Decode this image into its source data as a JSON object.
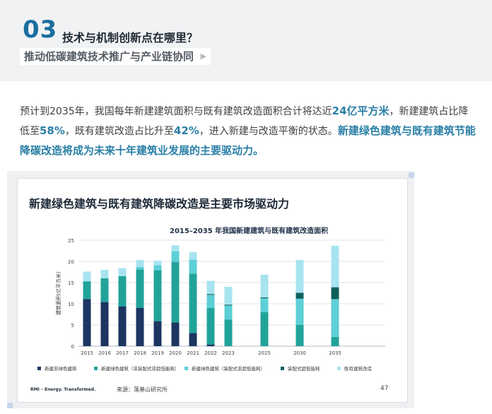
{
  "section": {
    "number": "03",
    "title": "技术与机制创新点在哪里？",
    "subtitle": "推动低碳建筑技术推广与产业链协同",
    "arrow_icon": "play-arrow-icon"
  },
  "paragraph": {
    "t1": "预计到2035年，我国每年新建建筑面积与既有建筑改造面积合计将达近",
    "h1": "24亿平方米",
    "t2": "，新建建筑占比降低至",
    "h2": "58%",
    "t3": "，既有建筑改造占比升至",
    "h3": "42%",
    "t4": "，进入新建与改造平衡的状态。",
    "h4": "新建绿色建筑与既有建筑节能降碳改造将成为未来十年建筑业发展的主要驱动力。",
    "highlight_color": "#2a7fa6"
  },
  "card": {
    "footer_brand": "RMI – Energy. Transformed.",
    "footer_source": "来源：落基山研究所",
    "page_number": "47"
  },
  "chart_data": {
    "type": "bar",
    "stacked": true,
    "title": "新建绿色建筑与既有建筑降碳改造是主要市场驱动力",
    "subtitle": "2015–2035 年我国新建建筑与既有建筑改造面积",
    "ylabel": "建筑面积(亿平方米)",
    "xlabel": "",
    "ylim": [
      0,
      25
    ],
    "yticks": [
      0,
      5,
      10,
      15,
      20,
      25
    ],
    "grid": true,
    "legend_position": "bottom",
    "categories": [
      "2015",
      "2016",
      "2017",
      "2018",
      "2019",
      "2020",
      "2021",
      "2022",
      "2023",
      "2025",
      "2030",
      "2035"
    ],
    "series": [
      {
        "name": "新建非绿色建筑",
        "color": "#1c3561",
        "values": [
          11.1,
          10.4,
          9.4,
          9.0,
          5.9,
          5.6,
          3.1,
          0.4,
          0,
          0,
          0,
          0
        ]
      },
      {
        "name": "新建绿色建筑（非装配式非超低能耗）",
        "color": "#21a39a",
        "values": [
          4.2,
          5.6,
          7.1,
          9.1,
          12.0,
          14.3,
          14.0,
          8.6,
          6.3,
          8.0,
          5.0,
          2.2
        ]
      },
      {
        "name": "新建绿色建筑（装配式非超低能耗）",
        "color": "#5dcfd7",
        "values": [
          0,
          0,
          0,
          0.6,
          1.2,
          2.5,
          3.3,
          3.1,
          3.3,
          3.3,
          6.2,
          8.9
        ]
      },
      {
        "name": "装配式超低能耗",
        "color": "#10605e",
        "values": [
          0,
          0,
          0,
          0,
          0,
          0,
          0,
          0.2,
          0.2,
          0.2,
          1.4,
          2.8
        ]
      },
      {
        "name": "既有建筑改造",
        "color": "#a8e3f0",
        "values": [
          2.3,
          2.0,
          1.9,
          1.6,
          1.1,
          1.4,
          1.8,
          3.1,
          4.2,
          5.4,
          7.7,
          9.8
        ]
      }
    ]
  }
}
